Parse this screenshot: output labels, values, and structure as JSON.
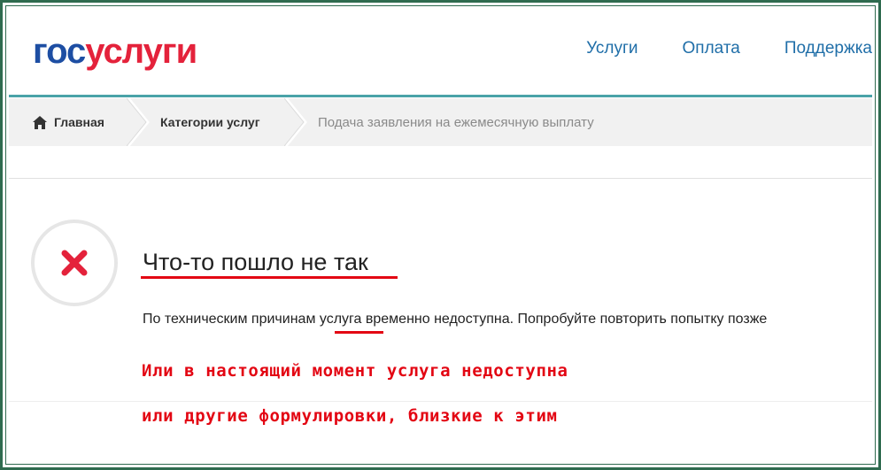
{
  "header": {
    "logo_part1": "гос",
    "logo_part2": "услуги",
    "nav": [
      {
        "label": "Услуги"
      },
      {
        "label": "Оплата"
      },
      {
        "label": "Поддержка"
      }
    ]
  },
  "breadcrumb": {
    "home": "Главная",
    "categories": "Категории услуг",
    "current": "Подача заявления на ежемесячную выплату"
  },
  "error": {
    "title": "Что-то пошло не так",
    "description": "По техническим причинам услуга временно недоступна. Попробуйте повторить попытку позже"
  },
  "annotations": {
    "note1": "Или в настоящий момент услуга недоступна",
    "note2": "или другие формулировки, близкие к этим"
  },
  "colors": {
    "brand_blue": "#1d4ea3",
    "brand_red": "#e4223b",
    "accent_teal": "#4aa3a8",
    "annotation_red": "#e30613",
    "frame_green": "#2f6b4f"
  },
  "icons": {
    "home": "home-icon",
    "error": "close-icon"
  }
}
